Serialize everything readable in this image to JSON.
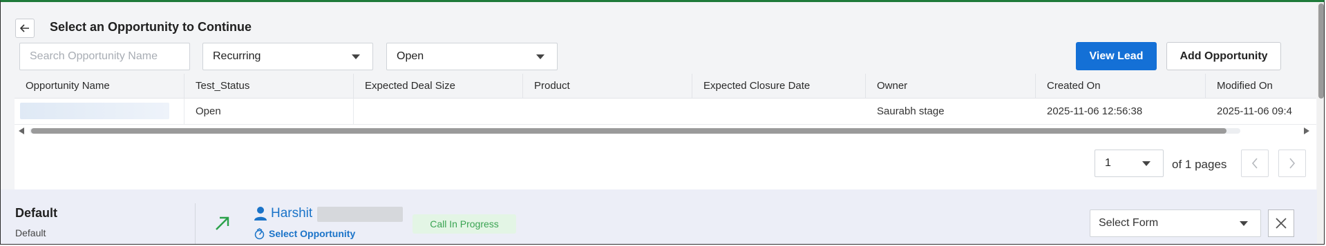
{
  "header": {
    "title": "Select an Opportunity to Continue"
  },
  "filters": {
    "search_placeholder": "Search Opportunity Name",
    "type_value": "Recurring",
    "status_value": "Open"
  },
  "actions": {
    "view_lead": "View Lead",
    "add_opportunity": "Add Opportunity"
  },
  "table": {
    "columns": [
      "Opportunity Name",
      "Test_Status",
      "Expected Deal Size",
      "Product",
      "Expected Closure Date",
      "Owner",
      "Created On",
      "Modified On"
    ],
    "rows": [
      {
        "name": "",
        "status": "Open",
        "deal_size": "",
        "product": "",
        "closure_date": "",
        "owner": "Saurabh stage",
        "created_on": "2025-11-06 12:56:38",
        "modified_on": "2025-11-06 09:4"
      }
    ]
  },
  "pagination": {
    "current_page": "1",
    "pages_text": "of 1 pages"
  },
  "bottom": {
    "title": "Default",
    "subtitle": "Default",
    "contact_name": "Harshit",
    "select_opportunity": "Select Opportunity",
    "call_status": "Call In Progress",
    "form_placeholder": "Select Form"
  },
  "colors": {
    "primary": "#1470d6",
    "link": "#1a73c8",
    "status_green": "#3aa352",
    "status_bg": "#e3f5e5"
  },
  "icons": [
    "back-arrow-icon",
    "caret-down-icon",
    "chevron-left-icon",
    "chevron-right-icon",
    "outgoing-call-arrow-icon",
    "person-icon",
    "opportunity-icon",
    "close-icon"
  ]
}
